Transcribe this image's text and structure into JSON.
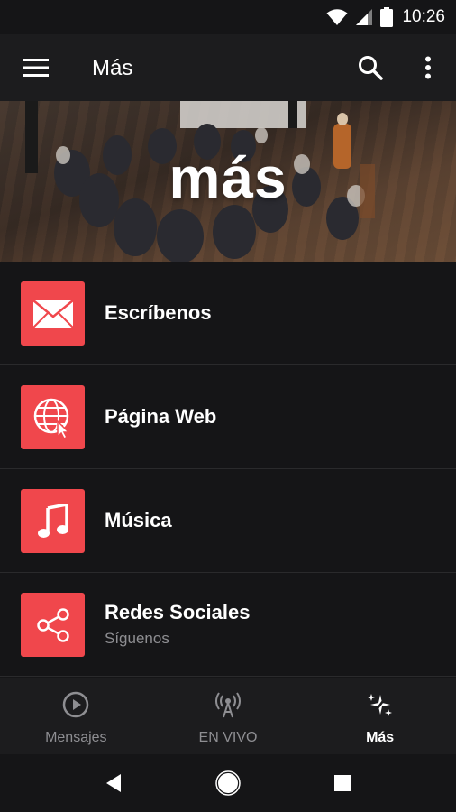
{
  "status_bar": {
    "time": "10:26",
    "icons": [
      "wifi-icon",
      "cell-signal-icon",
      "battery-icon"
    ]
  },
  "toolbar": {
    "title": "Más",
    "icons": [
      "menu-icon",
      "search-icon",
      "more-vertical-icon"
    ]
  },
  "banner": {
    "text": "más"
  },
  "list": {
    "items": [
      {
        "label": "Escríbenos",
        "icon": "mail-icon"
      },
      {
        "label": "Página Web",
        "icon": "globe-cursor-icon"
      },
      {
        "label": "Música",
        "icon": "music-note-icon"
      },
      {
        "label": "Redes Sociales",
        "sublabel": "Síguenos",
        "icon": "share-icon"
      }
    ]
  },
  "bottom_nav": {
    "items": [
      {
        "label": "Mensajes",
        "icon": "play-circle-icon",
        "active": false
      },
      {
        "label": "EN VIVO",
        "icon": "broadcast-icon",
        "active": false
      },
      {
        "label": "Más",
        "icon": "sparkle-icon",
        "active": true
      }
    ]
  },
  "system_nav": {
    "icons": [
      "back-icon",
      "home-icon",
      "recents-icon"
    ]
  },
  "colors": {
    "accent": "#f0474c",
    "background": "#151517",
    "toolbar": "#1c1c1e",
    "muted_text": "#8e8e92"
  }
}
